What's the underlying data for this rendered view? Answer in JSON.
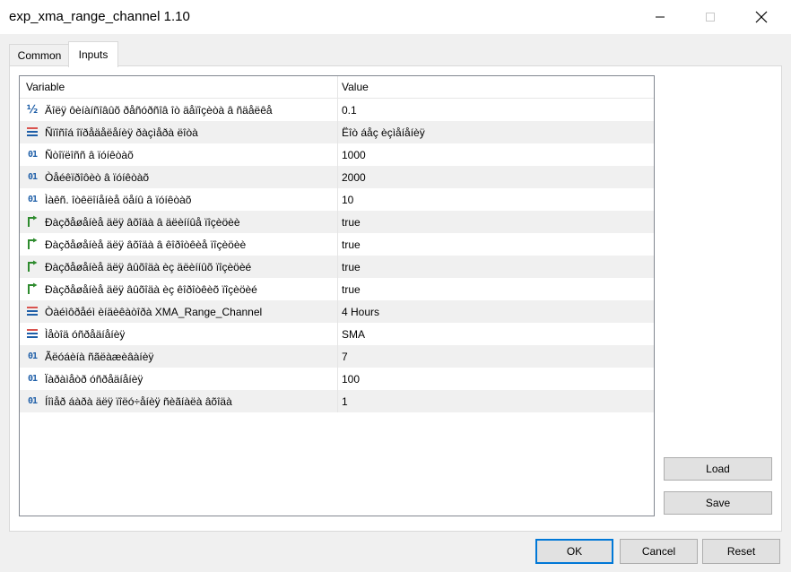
{
  "window": {
    "title": "exp_xma_range_channel 1.10"
  },
  "tabs": [
    {
      "label": "Common",
      "active": false
    },
    {
      "label": "Inputs",
      "active": true
    }
  ],
  "grid": {
    "col_variable": "Variable",
    "col_value": "Value",
    "rows": [
      {
        "icon": "fraction-icon",
        "name": "Äîëÿ ôèíàíñîâûõ ðåñóðñîâ îò äåïîçèòà â ñäåëêå",
        "value": "0.1"
      },
      {
        "icon": "enum-icon",
        "name": "Ñïîñîá îïðåäåëåíèÿ ðàçìåðà ëîòà",
        "value": "Ëîò áåç èçìåíåíèÿ"
      },
      {
        "icon": "int-icon",
        "name": "Ñòîïëîññ â ïóíêòàõ",
        "value": "1000"
      },
      {
        "icon": "int-icon",
        "name": "Òåéêïðîôèò â ïóíêòàõ",
        "value": "2000"
      },
      {
        "icon": "int-icon",
        "name": "Ìàêñ. îòêëîíåíèå öåíû â ïóíêòàõ",
        "value": "10"
      },
      {
        "icon": "bool-icon",
        "name": "Ðàçðåøåíèå äëÿ âõîäà â äëèííûå ïîçèöèè",
        "value": "true"
      },
      {
        "icon": "bool-icon",
        "name": "Ðàçðåøåíèå äëÿ âõîäà â êîðîòêèå ïîçèöèè",
        "value": "true"
      },
      {
        "icon": "bool-icon",
        "name": "Ðàçðåøåíèå äëÿ âûõîäà èç äëèííûõ ïîçèöèé",
        "value": "true"
      },
      {
        "icon": "bool-icon",
        "name": "Ðàçðåøåíèå äëÿ âûõîäà èç êîðîòêèõ ïîçèöèé",
        "value": "true"
      },
      {
        "icon": "enum-icon",
        "name": "Òàéìôðåéì èíäèêàòîðà XMA_Range_Channel",
        "value": "4 Hours"
      },
      {
        "icon": "enum-icon",
        "name": "Ìåòîä óñðåäíåíèÿ",
        "value": "SMA"
      },
      {
        "icon": "int-icon",
        "name": "Ãëóáèíà ñãëàæèâàíèÿ",
        "value": "7"
      },
      {
        "icon": "int-icon",
        "name": "Ïàðàìåòð óñðåäíåíèÿ",
        "value": "100"
      },
      {
        "icon": "int-icon",
        "name": "Íîìåð áàðà äëÿ ïîëó÷åíèÿ ñèãíàëà âõîäà",
        "value": "1"
      }
    ]
  },
  "buttons": {
    "load": "Load",
    "save": "Save",
    "ok": "OK",
    "cancel": "Cancel",
    "reset": "Reset"
  },
  "colors": {
    "accent": "#0078d7",
    "icon_blue": "#1f5fa8",
    "icon_green": "#2e8b2e",
    "icon_red": "#d9534f"
  }
}
